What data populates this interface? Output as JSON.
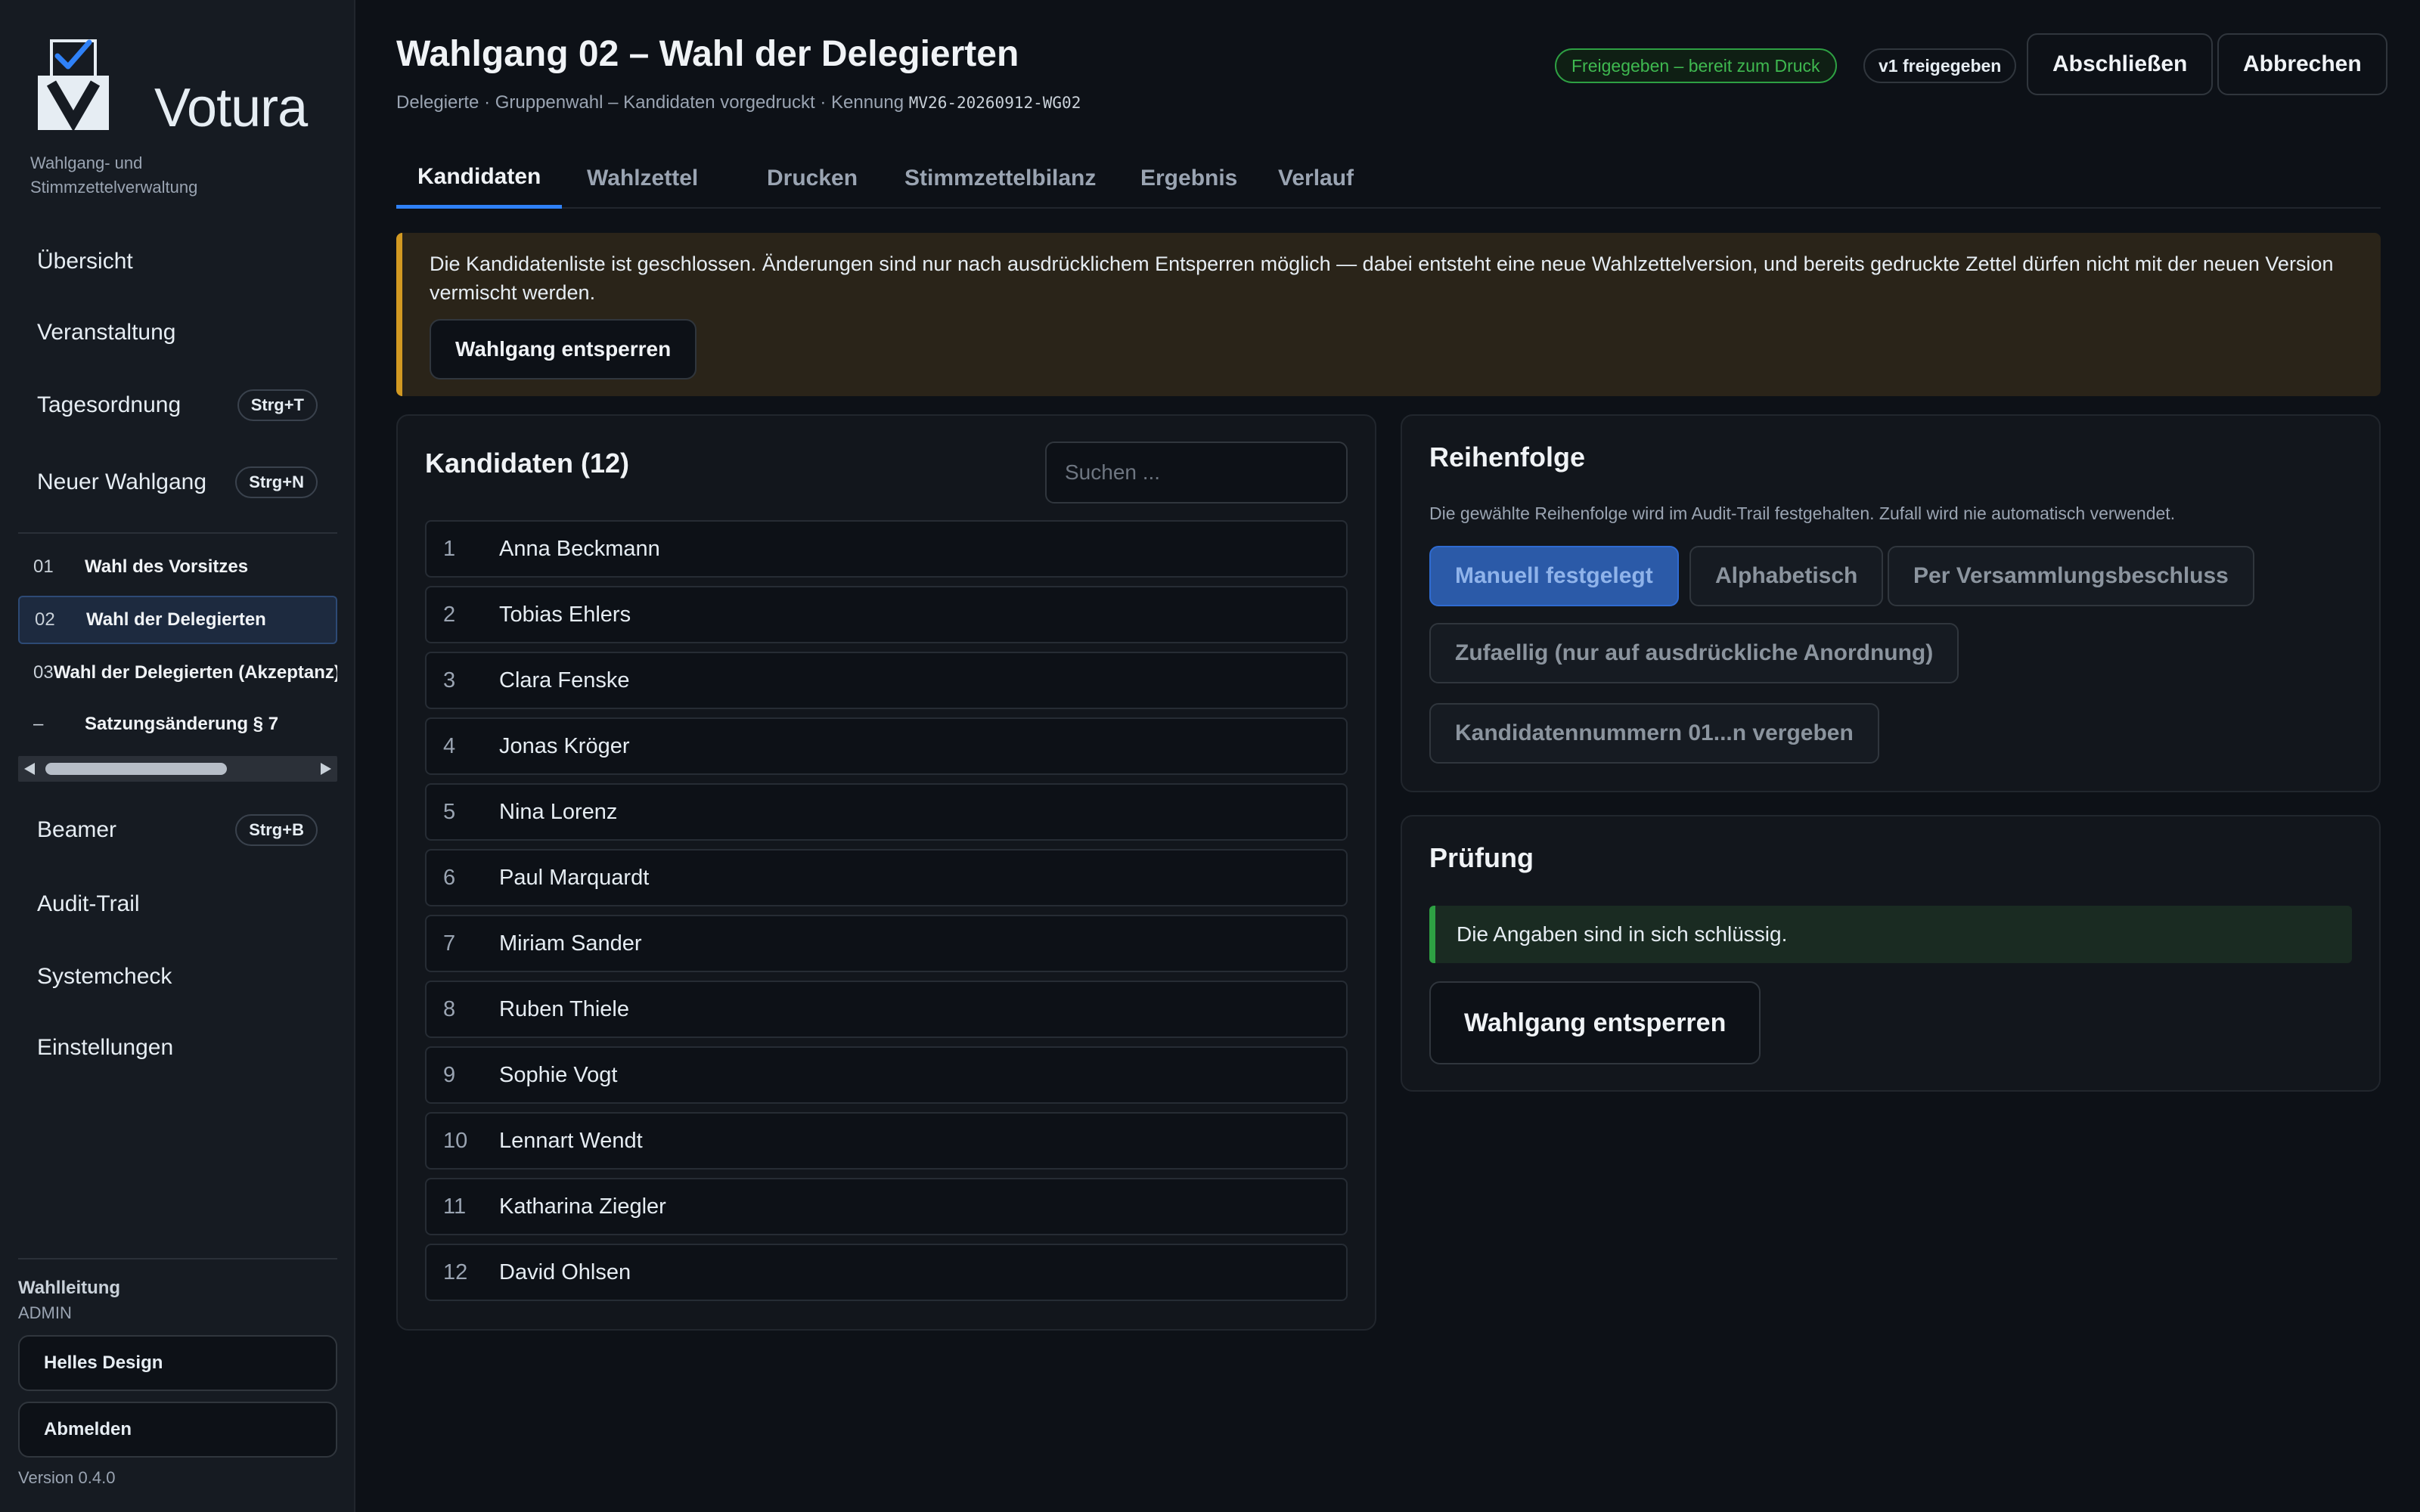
{
  "app": {
    "name": "Votura",
    "tagline": "Wahlgang- und Stimmzettelverwaltung",
    "version": "Version 0.4.0",
    "accent": "#2f81f7"
  },
  "sidebar": {
    "nav_top": [
      {
        "label": "Übersicht"
      },
      {
        "label": "Veranstaltung"
      },
      {
        "label": "Tagesordnung",
        "shortcut": "Strg+T"
      },
      {
        "label": "Neuer Wahlgang",
        "shortcut": "Strg+N"
      }
    ],
    "ballots": [
      {
        "num": "01",
        "title": "Wahl des Vorsitzes"
      },
      {
        "num": "02",
        "title": "Wahl der Delegierten",
        "active": true
      },
      {
        "num": "03",
        "title": "Wahl der Delegierten (Akzeptanz)"
      },
      {
        "num": "–",
        "title": "Satzungsänderung § 7"
      }
    ],
    "nav_bottom": [
      {
        "label": "Beamer",
        "shortcut": "Strg+B"
      },
      {
        "label": "Audit-Trail"
      },
      {
        "label": "Systemcheck"
      },
      {
        "label": "Einstellungen"
      }
    ],
    "role_label": "Wahlleitung",
    "role_value": "ADMIN",
    "theme_button": "Helles Design",
    "logout_button": "Abmelden"
  },
  "header": {
    "title": "Wahlgang 02 – Wahl der Delegierten",
    "subtitle": "Delegierte · Gruppenwahl – Kandidaten vorgedruckt · Kennung",
    "code": "MV26-20260912-WG02",
    "status_badge": "Freigegeben – bereit zum Druck",
    "version_badge": "v1 freigegeben",
    "close_button": "Abschließen",
    "cancel_button": "Abbrechen"
  },
  "tabs": [
    {
      "label": "Kandidaten",
      "active": true
    },
    {
      "label": "Wahlzettel"
    },
    {
      "label": "Drucken"
    },
    {
      "label": "Stimmzettelbilanz"
    },
    {
      "label": "Ergebnis"
    },
    {
      "label": "Verlauf"
    }
  ],
  "warning": {
    "text": "Die Kandidatenliste ist geschlossen. Änderungen sind nur nach ausdrücklichem Entsperren möglich — dabei entsteht eine neue Wahlzettelversion, und bereits gedruckte Zettel dürfen nicht mit der neuen Version vermischt werden.",
    "button": "Wahlgang entsperren"
  },
  "candidates": {
    "title": "Kandidaten (12)",
    "search_placeholder": "Suchen ...",
    "items": [
      {
        "num": "1",
        "name": "Anna Beckmann"
      },
      {
        "num": "2",
        "name": "Tobias Ehlers"
      },
      {
        "num": "3",
        "name": "Clara Fenske"
      },
      {
        "num": "4",
        "name": "Jonas Kröger"
      },
      {
        "num": "5",
        "name": "Nina Lorenz"
      },
      {
        "num": "6",
        "name": "Paul Marquardt"
      },
      {
        "num": "7",
        "name": "Miriam Sander"
      },
      {
        "num": "8",
        "name": "Ruben Thiele"
      },
      {
        "num": "9",
        "name": "Sophie Vogt"
      },
      {
        "num": "10",
        "name": "Lennart Wendt"
      },
      {
        "num": "11",
        "name": "Katharina Ziegler"
      },
      {
        "num": "12",
        "name": "David Ohlsen"
      }
    ]
  },
  "order": {
    "title": "Reihenfolge",
    "hint": "Die gewählte Reihenfolge wird im Audit-Trail festgehalten. Zufall wird nie automatisch verwendet.",
    "options": [
      {
        "label": "Manuell festgelegt",
        "active": true
      },
      {
        "label": "Alphabetisch"
      },
      {
        "label": "Per Versammlungsbeschluss"
      },
      {
        "label": "Zufaellig (nur auf ausdrückliche Anordnung)"
      },
      {
        "label": "Kandidatennummern 01...n vergeben"
      }
    ]
  },
  "check": {
    "title": "Prüfung",
    "ok_text": "Die Angaben sind in sich schlüssig.",
    "button": "Wahlgang entsperren"
  }
}
